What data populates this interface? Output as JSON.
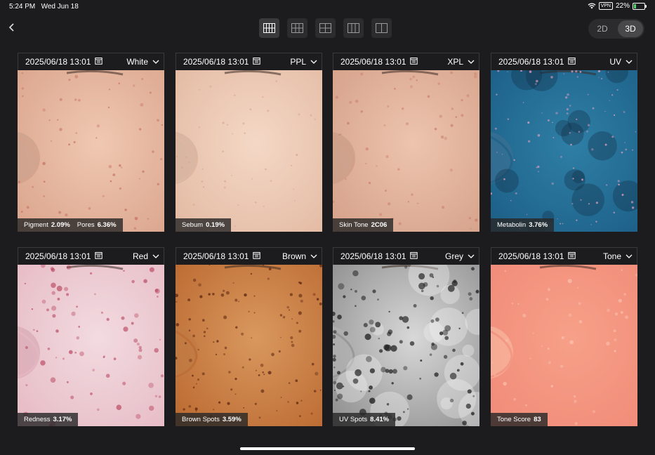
{
  "status": {
    "time": "5:24 PM",
    "date": "Wed Jun 18",
    "vpn": "VPN",
    "battery": "22%",
    "battery_level": 0.22
  },
  "toolbar": {
    "layouts": [
      "grid-4x2-icon",
      "grid-3x2-icon",
      "grid-2x2-icon",
      "grid-3col-icon",
      "grid-2col-icon"
    ],
    "dim_2d": "2D",
    "dim_3d": "3D",
    "active_dim": "3D"
  },
  "cells": [
    {
      "date": "2025/06/18 13:01",
      "mode": "White",
      "metrics": [
        {
          "label": "Pigment",
          "value": "2.09%"
        },
        {
          "label": "Pores",
          "value": "6.36%"
        }
      ]
    },
    {
      "date": "2025/06/18 13:01",
      "mode": "PPL",
      "metrics": [
        {
          "label": "Sebum",
          "value": "0.19%"
        }
      ]
    },
    {
      "date": "2025/06/18 13:01",
      "mode": "XPL",
      "metrics": [
        {
          "label": "Skin Tone",
          "value": "2C06"
        }
      ]
    },
    {
      "date": "2025/06/18 13:01",
      "mode": "UV",
      "metrics": [
        {
          "label": "Metabolin",
          "value": "3.76%"
        }
      ]
    },
    {
      "date": "2025/06/18 13:01",
      "mode": "Red",
      "metrics": [
        {
          "label": "Redness",
          "value": "3.17%"
        }
      ]
    },
    {
      "date": "2025/06/18 13:01",
      "mode": "Brown",
      "metrics": [
        {
          "label": "Brown Spots",
          "value": "3.59%"
        }
      ]
    },
    {
      "date": "2025/06/18 13:01",
      "mode": "Grey",
      "metrics": [
        {
          "label": "UV Spots",
          "value": "8.41%"
        }
      ]
    },
    {
      "date": "2025/06/18 13:01",
      "mode": "Tone",
      "metrics": [
        {
          "label": "Tone Score",
          "value": "83"
        }
      ]
    }
  ],
  "colors": {
    "background": "#1c1c1e",
    "panel": "#2c2c2e",
    "badge": "#282828"
  }
}
